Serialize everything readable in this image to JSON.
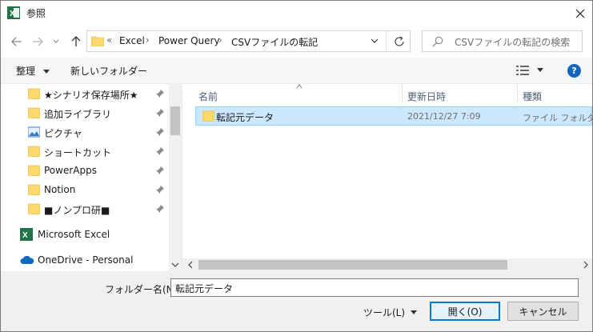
{
  "window": {
    "title": "参照",
    "app_icon": "excel-icon",
    "close_icon": "close-icon"
  },
  "nav": {
    "breadcrumb_overflow": "«",
    "breadcrumbs": [
      "Excel",
      "Power Query",
      "CSVファイルの転記"
    ],
    "search_placeholder": "CSVファイルの転記の検索"
  },
  "toolbar": {
    "organize": "整理",
    "new_folder": "新しいフォルダー"
  },
  "sidebar": {
    "items": [
      {
        "label": "★シナリオ保存場所★",
        "icon": "folder-icon",
        "pinned": true
      },
      {
        "label": "追加ライブラリ",
        "icon": "folder-icon",
        "pinned": true
      },
      {
        "label": "ピクチャ",
        "icon": "pictures-icon",
        "pinned": true
      },
      {
        "label": "ショートカット",
        "icon": "folder-icon",
        "pinned": true
      },
      {
        "label": "PowerApps",
        "icon": "folder-icon",
        "pinned": true
      },
      {
        "label": "Notion",
        "icon": "folder-icon",
        "pinned": true
      },
      {
        "label": "■ノンプロ研■",
        "icon": "folder-icon",
        "pinned": true
      }
    ],
    "excel": "Microsoft Excel",
    "onedrive": "OneDrive - Personal"
  },
  "filelist": {
    "columns": [
      "名前",
      "更新日時",
      "種類"
    ],
    "rows": [
      {
        "name": "転記元データ",
        "modified": "2021/12/27 7:09",
        "type": "ファイル フォルダー",
        "selected": true
      }
    ]
  },
  "bottom": {
    "filename_label": "フォルダー名(N):",
    "filename_value": "転記元データ",
    "tools": "ツール(L)",
    "open": "開く(O)",
    "cancel": "キャンセル"
  },
  "colors": {
    "selection": "#cce8ff",
    "selection_border": "#99d1ff",
    "folder": "#ffd86b",
    "accent": "#0078d7",
    "excel_green": "#217346"
  }
}
